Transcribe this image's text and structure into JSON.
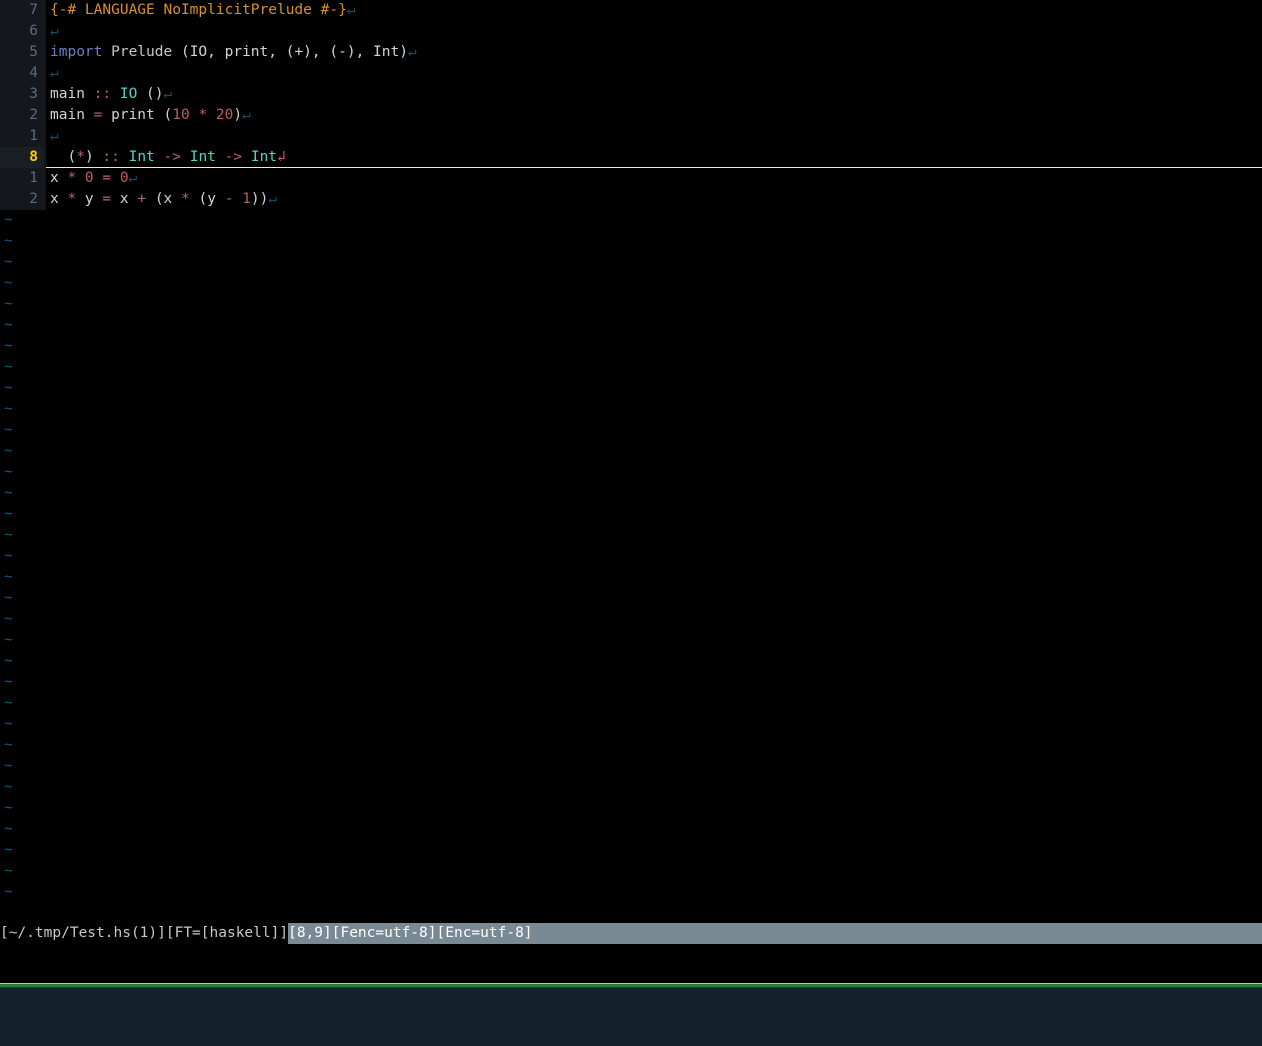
{
  "gutter": {
    "l1": "7",
    "l2": "6",
    "l3": "5",
    "l4": "4",
    "l5": "3",
    "l6": "2",
    "l7": "1",
    "l8": "8",
    "l9": "1",
    "l10": "2"
  },
  "eol": "↵",
  "cursor_eol": "↲",
  "code": {
    "line1": {
      "pragma": "{-# LANGUAGE NoImplicitPrelude #-}"
    },
    "line3": {
      "import_kw": "import",
      "module": " Prelude ",
      "imports": "(IO, print, (+), (-), Int)"
    },
    "line5": {
      "name": "main ",
      "dcolon": "::",
      "io": " IO ",
      "unit": "()"
    },
    "line6": {
      "name": "main ",
      "eq": "=",
      "fn": " print ",
      "lparen": "(",
      "n1": "10",
      "star": " * ",
      "n2": "20",
      "rparen": ")"
    },
    "line8": {
      "pad": "  ",
      "lparen": "(",
      "star": "*",
      "rparen": ")",
      "dcolon": " :: ",
      "int1": "Int",
      "arr1": " -> ",
      "int2": "Int",
      "arr2": " -> ",
      "int3": "Int"
    },
    "line9": {
      "x": "x ",
      "star": "*",
      "zero1": " 0 ",
      "eq": "=",
      "zero2": " 0"
    },
    "line10": {
      "x": "x ",
      "star1": "*",
      "y": " y ",
      "eq": "=",
      "x2": " x ",
      "plus": "+",
      "sp1": " ",
      "lparen1": "(",
      "x3": "x ",
      "star2": "*",
      "sp2": " ",
      "lparen2": "(",
      "y2": "y ",
      "minus": "-",
      "one": " 1",
      "rparen2": ")",
      "rparen1": ")"
    }
  },
  "status": {
    "left": "[~/.tmp/Test.hs(1)][FT=[haskell]]",
    "right": "[8,9][Fenc=utf-8][Enc=utf-8]"
  },
  "tilde": "~"
}
